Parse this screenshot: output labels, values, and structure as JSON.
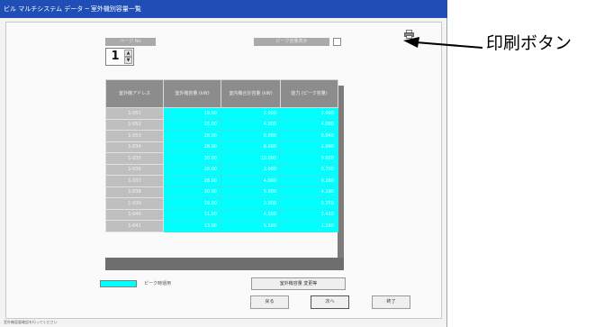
{
  "window": {
    "title": "ビル マルチシステム データ ─ 室外機別容量一覧"
  },
  "page": {
    "label": "ページ No",
    "number": "1",
    "up": "▲",
    "down": "▼"
  },
  "checkbox": {
    "label": "ピーク容量表示"
  },
  "table": {
    "headers": [
      "室外機アドレス",
      "室外機容量 (kW)",
      "室内機合計容量 (kW)",
      "能力 (ピーク容量)"
    ],
    "rows": [
      [
        "1-051",
        "19.00",
        "2.000",
        "2.090"
      ],
      [
        "1-052",
        "15.00",
        "4.000",
        "4.080"
      ],
      [
        "1-053",
        "28.00",
        "8.000",
        "8.040"
      ],
      [
        "1-034",
        "28.00",
        "8.000",
        "2.090"
      ],
      [
        "1-035",
        "30.00",
        "10.000",
        "9.020"
      ],
      [
        "1-036",
        "28.00",
        "3.000",
        "0.700"
      ],
      [
        "1-037",
        "28.00",
        "4.000",
        "0.280"
      ],
      [
        "1-038",
        "20.00",
        "5.000",
        "4.190"
      ],
      [
        "1-039",
        "19.00",
        "2.000",
        "5.250"
      ],
      [
        "1-040",
        "11.00",
        "4.500",
        "2.450"
      ],
      [
        "1-041",
        "13.00",
        "5.500",
        "1.260"
      ]
    ]
  },
  "legend": {
    "text": "ピーク時運用"
  },
  "buttons": {
    "wide": "室外機容量 変更等",
    "back": "戻る",
    "next": "次へ",
    "end": "終了"
  },
  "statusbar": {
    "text": "室外機容量確認を行ってください"
  },
  "annotation": {
    "text": "印刷ボタン"
  },
  "colors": {
    "highlight": "#00ffff",
    "titlebar": "#1f4fb6"
  }
}
